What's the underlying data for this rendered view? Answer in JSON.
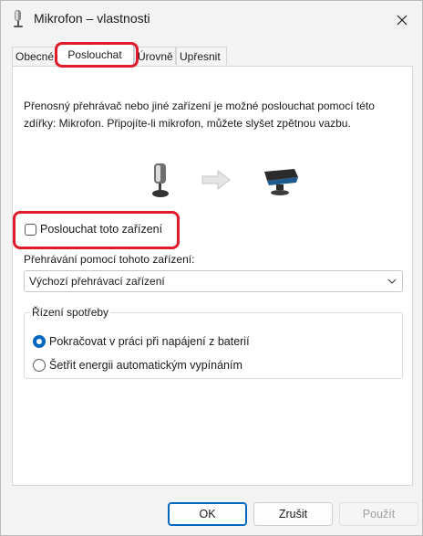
{
  "window": {
    "title": "Mikrofon – vlastnosti",
    "title_icon": "microphone-icon",
    "close_icon": "close-icon"
  },
  "tabs": [
    {
      "label": "Obecné",
      "active": false
    },
    {
      "label": "Poslouchat",
      "active": true
    },
    {
      "label": "Úrovně",
      "active": false
    },
    {
      "label": "Upřesnit",
      "active": false
    }
  ],
  "panel": {
    "description": "Přenosný přehrávač nebo jiné zařízení je možné poslouchat pomocí této zdířky: Mikrofon. Připojíte-li mikrofon, můžete slyšet zpětnou vazbu.",
    "illustration": {
      "source_icon": "microphone-icon",
      "arrow_icon": "arrow-right-icon",
      "target_icon": "speaker-icon"
    },
    "listen_checkbox": {
      "label": "Poslouchat toto zařízení",
      "checked": false
    },
    "playback": {
      "label": "Přehrávání pomocí tohoto zařízení:",
      "selected": "Výchozí přehrávací zařízení"
    },
    "power": {
      "title": "Řízení spotřeby",
      "options": [
        {
          "label": "Pokračovat v práci při napájení z baterií",
          "checked": true
        },
        {
          "label": "Šetřit energii automatickým vypínáním",
          "checked": false
        }
      ]
    }
  },
  "buttons": {
    "ok": "OK",
    "cancel": "Zrušit",
    "apply": "Použít",
    "apply_enabled": false
  },
  "highlight_color": "#e01b2a",
  "accent_color": "#0067c0"
}
